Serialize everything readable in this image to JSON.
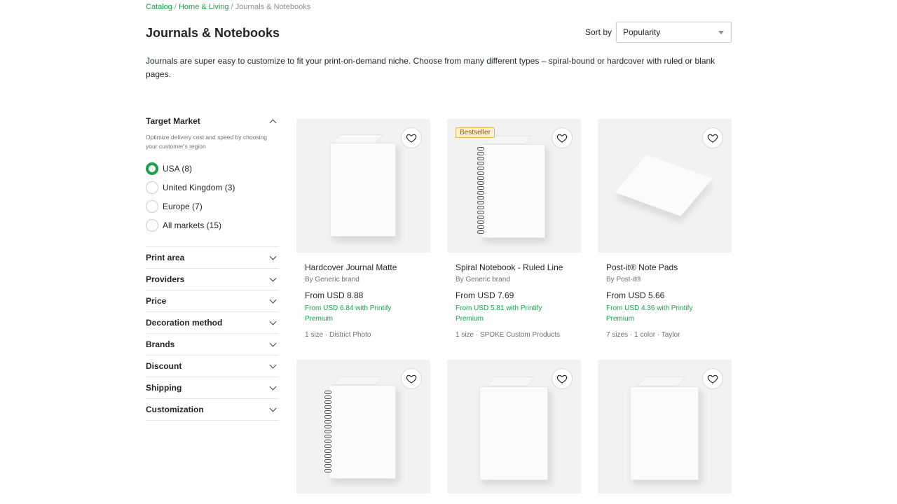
{
  "breadcrumb": {
    "items": [
      "Catalog",
      "Home & Living"
    ],
    "separator": "/",
    "current": "Journals & Notebooks"
  },
  "page": {
    "title": "Journals & Notebooks",
    "description": "Journals are super easy to customize to fit your print-on-demand niche. Choose from many different types – spiral-bound or hardcover with ruled or blank pages."
  },
  "sort": {
    "label": "Sort by",
    "value": "Popularity"
  },
  "sidebar": {
    "target_market": {
      "title": "Target Market",
      "hint": "Optimize delivery cost and speed by choosing your customer's region",
      "options": [
        {
          "label": "USA (8)",
          "checked": true
        },
        {
          "label": "United Kingdom (3)",
          "checked": false
        },
        {
          "label": "Europe (7)",
          "checked": false
        },
        {
          "label": "All markets (15)",
          "checked": false
        }
      ]
    },
    "filters": [
      "Print area",
      "Providers",
      "Price",
      "Decoration method",
      "Brands",
      "Discount",
      "Shipping",
      "Customization"
    ]
  },
  "products": [
    {
      "title": "Hardcover Journal Matte",
      "brand": "By Generic brand",
      "price": "From USD 8.88",
      "premium": "From USD 6.84 with Printify Premium",
      "meta": "1 size · District Photo",
      "badge": ""
    },
    {
      "title": "Spiral Notebook - Ruled Line",
      "brand": "By Generic brand",
      "price": "From USD 7.69",
      "premium": "From USD 5.81 with Printify Premium",
      "meta": "1 size · SPOKE Custom Products",
      "badge": "Bestseller"
    },
    {
      "title": "Post-it® Note Pads",
      "brand": "By Post-it®",
      "price": "From USD 5.66",
      "premium": "From USD 4.36 with Printify Premium",
      "meta": "7 sizes · 1 color · Taylor",
      "badge": ""
    }
  ],
  "icons": {
    "heart": "heart-icon",
    "chevron": "chevron-down-icon",
    "dropdown": "caret-down-icon"
  },
  "colors": {
    "accent": "#17a34a",
    "badge_bg": "#fdf0d5",
    "text": "#1f2529"
  }
}
